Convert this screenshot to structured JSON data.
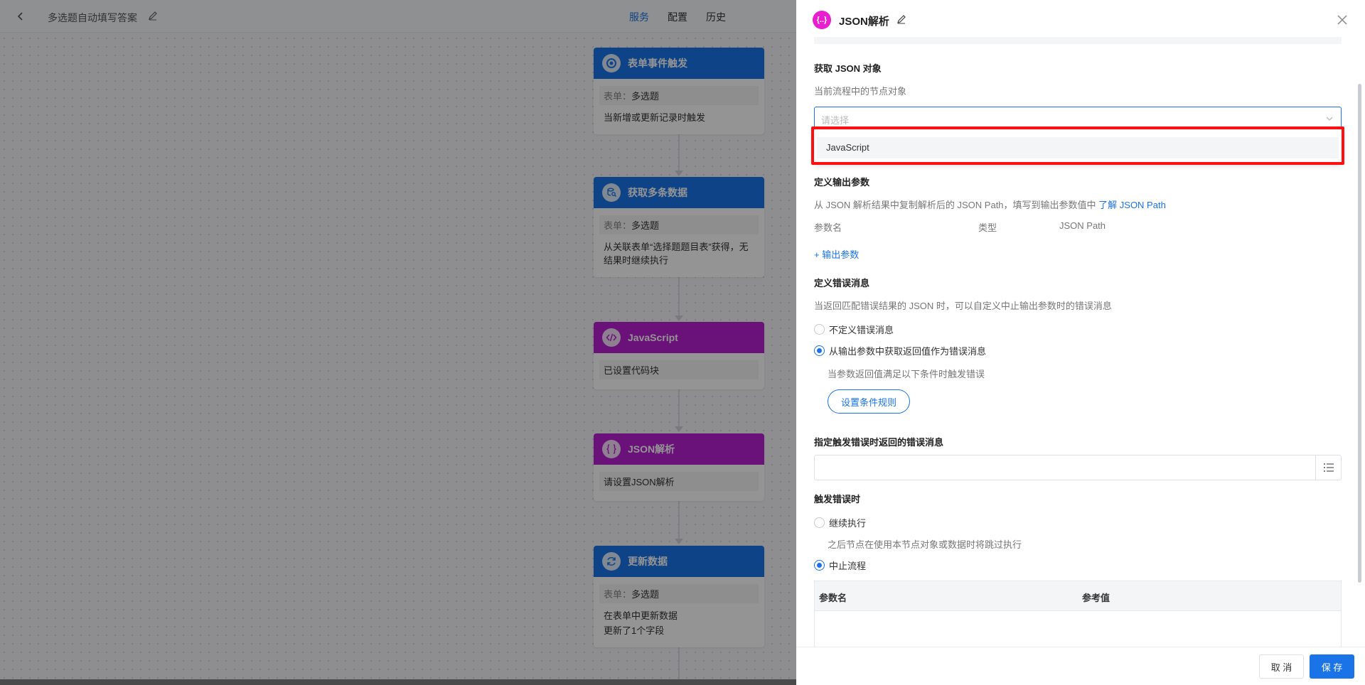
{
  "canvas": {
    "flow_name": "多选题自动填写答案",
    "tabs": [
      {
        "label": "服务",
        "active": true
      },
      {
        "label": "配置",
        "active": false
      },
      {
        "label": "历史",
        "active": false
      }
    ],
    "nodes": [
      {
        "title": "表单事件触发",
        "color": "blue",
        "form_label": "表单：",
        "form_value": "多选题",
        "text": "当新增或更新记录时触发"
      },
      {
        "title": "获取多条数据",
        "color": "blue",
        "form_label": "表单：",
        "form_value": "多选题",
        "text": "从关联表单“选择题题目表”获得，无结果时继续执行"
      },
      {
        "title": "JavaScript",
        "color": "purple",
        "line": "已设置代码块"
      },
      {
        "title": "JSON解析",
        "color": "purple",
        "line": "请设置JSON解析"
      },
      {
        "title": "更新数据",
        "color": "blue",
        "form_label": "表单：",
        "form_value": "多选题",
        "text1": "在表单中更新数据",
        "text2": "更新了1个字段"
      }
    ]
  },
  "drawer": {
    "icon_text": "{..}",
    "title": "JSON解析",
    "get_json": {
      "title": "获取 JSON 对象",
      "desc": "当前流程中的节点对象",
      "placeholder": "请选择",
      "options": [
        "JavaScript"
      ]
    },
    "output": {
      "title": "定义输出参数",
      "desc": "从 JSON 解析结果中复制解析后的 JSON Path，填写到输出参数值中 ",
      "learn_link": "了解 JSON Path",
      "columns": [
        "参数名",
        "类型",
        "JSON Path"
      ],
      "add_label": "+ 输出参数"
    },
    "error_msg": {
      "title": "定义错误消息",
      "desc": "当返回匹配错误结果的 JSON 时，可以自定义中止输出参数时的错误消息",
      "opt_none": "不定义错误消息",
      "opt_from_output": "从输出参数中获取返回值作为错误消息",
      "selected": "opt_from_output",
      "cond_desc": "当参数返回值满足以下条件时触发错误",
      "cond_button": "设置条件规则"
    },
    "specify_msg": {
      "title": "指定触发错误时返回的错误消息"
    },
    "on_error": {
      "title": "触发错误时",
      "opt_continue": "继续执行",
      "continue_desc": "之后节点在使用本节点对象或数据时将跳过执行",
      "opt_stop": "中止流程",
      "selected": "opt_stop",
      "table_cols": [
        "参数名",
        "参考值"
      ]
    },
    "footer": {
      "cancel": "取 消",
      "save": "保 存"
    }
  },
  "colors": {
    "primary": "#1a74e8",
    "purple": "#b71fd0",
    "drawer_icon": "#e81ecf",
    "highlight": "#ff1010"
  }
}
